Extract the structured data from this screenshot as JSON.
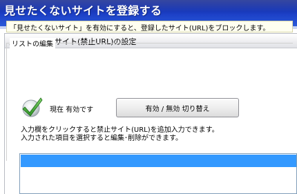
{
  "page": {
    "title": "見せたくないサイトを登録する"
  },
  "section": {
    "title": "見せたくないサイト(禁止URL)の設定",
    "info": "「見せたくないサイト」を有効にすると、登録したサイト(URL)をブロックします。"
  },
  "list_edit": {
    "group_title": "リストの編集",
    "status_text": "現在 有効です",
    "status_icon": "checkmark-icon",
    "status_color": "#3fa535",
    "toggle_label": "有効 / 無効  切り替え",
    "instruction_1": "入力欄をクリックすると禁止サイト(URL)を追加入力できます。",
    "instruction_2": "入力された項目を選択すると編集･削除ができます。",
    "selection_color": "#3399ff"
  },
  "colors": {
    "title_band": "#1c40c7",
    "info_background": "#fffff0"
  }
}
